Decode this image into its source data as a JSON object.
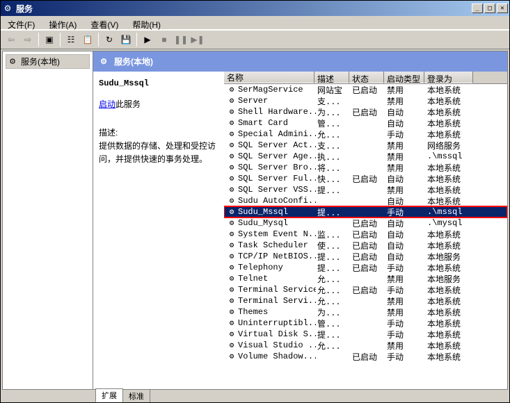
{
  "window": {
    "title": "服务"
  },
  "menu": {
    "file": "文件(F)",
    "action": "操作(A)",
    "view": "查看(V)",
    "help": "帮助(H)"
  },
  "tree": {
    "root": "服务(本地)"
  },
  "header": {
    "title": "服务(本地)"
  },
  "info": {
    "selected_name": "Sudu_Mssql",
    "start_action_prefix": "启动",
    "start_action_suffix": "此服务",
    "desc_label": "描述:",
    "desc_text": "提供数据的存储、处理和受控访问，并提供快速的事务处理。"
  },
  "columns": {
    "name": "名称",
    "desc": "描述",
    "status": "状态",
    "startup": "启动类型",
    "logon": "登录为"
  },
  "services": [
    {
      "name": "SerMagService",
      "desc": "网站宝",
      "status": "已启动",
      "startup": "禁用",
      "logon": "本地系统"
    },
    {
      "name": "Server",
      "desc": "支...",
      "status": "",
      "startup": "禁用",
      "logon": "本地系统"
    },
    {
      "name": "Shell Hardware...",
      "desc": "为...",
      "status": "已启动",
      "startup": "自动",
      "logon": "本地系统"
    },
    {
      "name": "Smart Card",
      "desc": "管...",
      "status": "",
      "startup": "自动",
      "logon": "本地系统"
    },
    {
      "name": "Special Admini...",
      "desc": "允...",
      "status": "",
      "startup": "手动",
      "logon": "本地系统"
    },
    {
      "name": "SQL Server Act...",
      "desc": "支...",
      "status": "",
      "startup": "禁用",
      "logon": "网络服务"
    },
    {
      "name": "SQL Server Age...",
      "desc": "执...",
      "status": "",
      "startup": "禁用",
      "logon": ".\\mssql"
    },
    {
      "name": "SQL Server Bro...",
      "desc": "将...",
      "status": "",
      "startup": "禁用",
      "logon": "本地系统"
    },
    {
      "name": "SQL Server Ful...",
      "desc": "快...",
      "status": "已启动",
      "startup": "自动",
      "logon": "本地系统"
    },
    {
      "name": "SQL Server VSS...",
      "desc": "提...",
      "status": "",
      "startup": "禁用",
      "logon": "本地系统"
    },
    {
      "name": "Sudu AutoConfi...",
      "desc": "",
      "status": "",
      "startup": "自动",
      "logon": "本地系统"
    },
    {
      "name": "Sudu_Mssql",
      "desc": "提...",
      "status": "",
      "startup": "手动",
      "logon": ".\\mssql",
      "selected": true,
      "highlight": true
    },
    {
      "name": "Sudu_Mysql",
      "desc": "",
      "status": "已启动",
      "startup": "自动",
      "logon": ".\\mysql"
    },
    {
      "name": "System Event N...",
      "desc": "监...",
      "status": "已启动",
      "startup": "自动",
      "logon": "本地系统"
    },
    {
      "name": "Task Scheduler",
      "desc": "使...",
      "status": "已启动",
      "startup": "自动",
      "logon": "本地系统"
    },
    {
      "name": "TCP/IP NetBIOS...",
      "desc": "提...",
      "status": "已启动",
      "startup": "自动",
      "logon": "本地服务"
    },
    {
      "name": "Telephony",
      "desc": "提...",
      "status": "已启动",
      "startup": "手动",
      "logon": "本地系统"
    },
    {
      "name": "Telnet",
      "desc": "允...",
      "status": "",
      "startup": "禁用",
      "logon": "本地服务"
    },
    {
      "name": "Terminal Services",
      "desc": "允...",
      "status": "已启动",
      "startup": "手动",
      "logon": "本地系统"
    },
    {
      "name": "Terminal Servi...",
      "desc": "允...",
      "status": "",
      "startup": "禁用",
      "logon": "本地系统"
    },
    {
      "name": "Themes",
      "desc": "为...",
      "status": "",
      "startup": "禁用",
      "logon": "本地系统"
    },
    {
      "name": "Uninterruptibl...",
      "desc": "管...",
      "status": "",
      "startup": "手动",
      "logon": "本地系统"
    },
    {
      "name": "Virtual Disk S...",
      "desc": "提...",
      "status": "",
      "startup": "手动",
      "logon": "本地系统"
    },
    {
      "name": "Visual Studio ...",
      "desc": "允...",
      "status": "",
      "startup": "禁用",
      "logon": "本地系统"
    },
    {
      "name": "Volume Shadow...",
      "desc": "",
      "status": "已启动",
      "startup": "手动",
      "logon": "本地系统"
    }
  ],
  "tabs": {
    "extended": "扩展",
    "standard": "标准"
  }
}
